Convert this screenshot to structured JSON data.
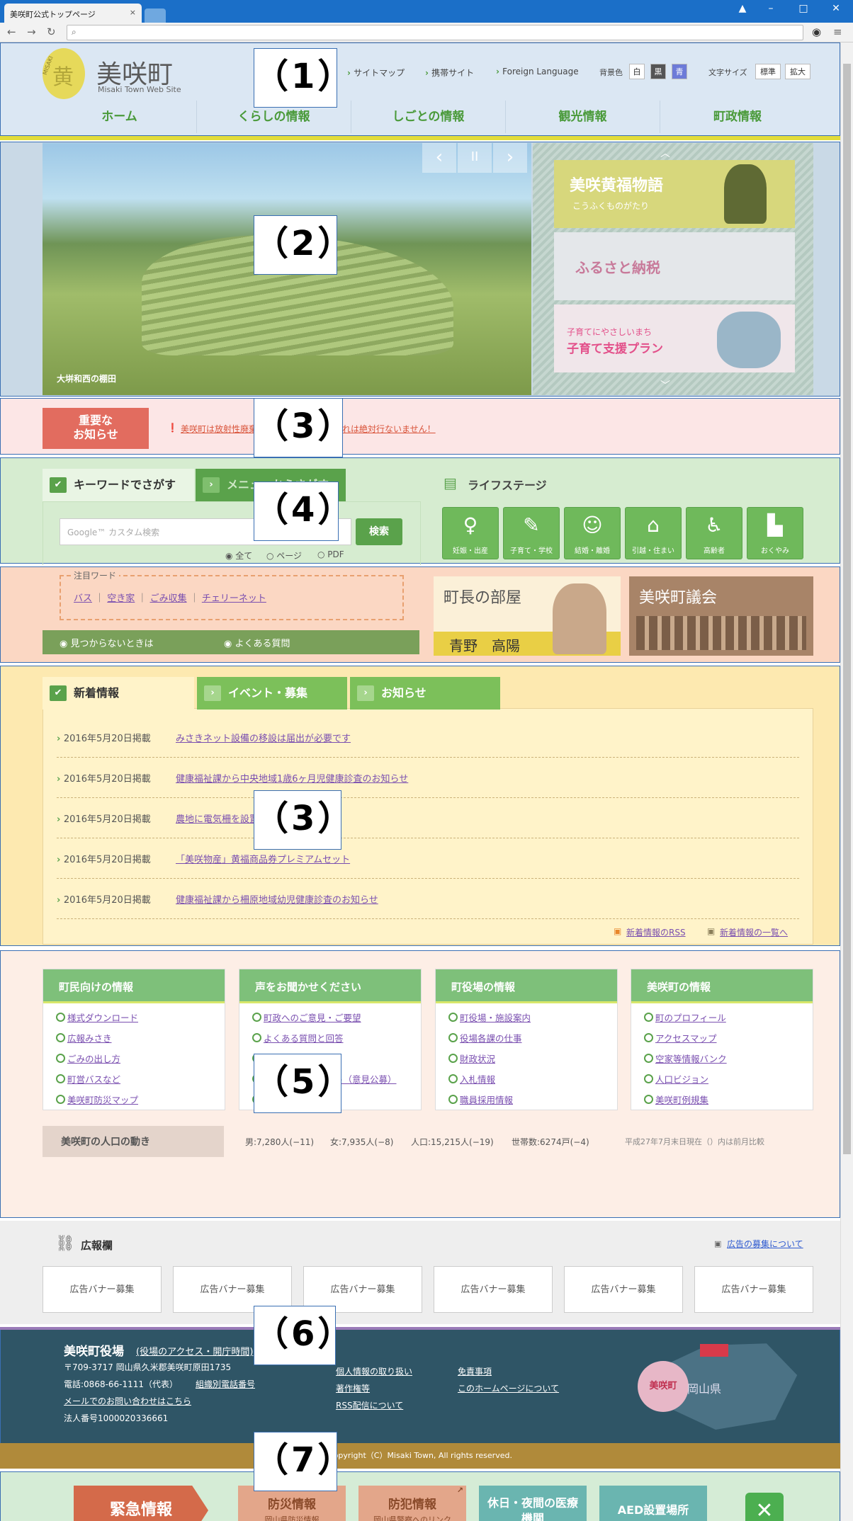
{
  "browser": {
    "tab_title": "美咲町公式トップページ",
    "tab_close": "×",
    "url": ""
  },
  "header": {
    "logo_text": "黄",
    "logo_small": "MISAKI",
    "site_title": "美咲町",
    "site_subtitle": "Misaki Town Web Site",
    "links": [
      "サイトマップ",
      "携帯サイト",
      "Foreign Language"
    ],
    "bg_color_label": "背景色",
    "bg_colors": [
      "白",
      "黒",
      "青"
    ],
    "text_size_label": "文字サイズ",
    "text_sizes": [
      "標準",
      "拡大"
    ]
  },
  "nav": [
    "ホーム",
    "くらしの情報",
    "しごとの情報",
    "観光情報",
    "町政情報"
  ],
  "slider": {
    "caption": "大垪和西の棚田",
    "prev": "‹",
    "pause": "II",
    "next": "›",
    "banners": [
      {
        "title": "美咲黄福物語",
        "sub": "こうふくものがたり"
      },
      {
        "title": "ふるさと納税",
        "sub": ""
      },
      {
        "title": "子育て支援プラン",
        "sub": "子育てにやさしいまち"
      }
    ]
  },
  "important": {
    "label_line1": "重要な",
    "label_line2": "お知らせ",
    "text": "美咲町は放射性廃棄物の最終処分場の受入れは絶対行ないません！"
  },
  "search": {
    "tab_keyword": "キーワードでさがす",
    "tab_menu": "メニューからさがす",
    "placeholder": "Google™ カスタム検索",
    "button": "検索",
    "radios": [
      "全て",
      "ページ",
      "PDF"
    ],
    "attention_title": "注目ワード",
    "attention_words": [
      "バス",
      "空き家",
      "ごみ収集",
      "チェリーネット"
    ],
    "not_found": "見つからないときは",
    "faq": "よくある質問"
  },
  "lifestage": {
    "title": "ライフステージ",
    "items": [
      "妊娠・出産",
      "子育て・学校",
      "結婚・離婚",
      "引越・住まい",
      "高齢者",
      "おくやみ"
    ]
  },
  "mayor": {
    "title": "町長の部屋",
    "name": "青野　高陽"
  },
  "council": {
    "title": "美咲町議会"
  },
  "news": {
    "tabs": [
      "新着情報",
      "イベント・募集",
      "お知らせ"
    ],
    "items": [
      {
        "date": "2016年5月20日掲載",
        "title": "みさきネット設備の移設は届出が必要です"
      },
      {
        "date": "2016年5月20日掲載",
        "title": "健康福祉課から中央地域1歳6ヶ月児健康診査のお知らせ"
      },
      {
        "date": "2016年5月20日掲載",
        "title": "農地に電気柵を設置する場合の注意点"
      },
      {
        "date": "2016年5月20日掲載",
        "title": "「美咲物産」黄福商品券プレミアムセット"
      },
      {
        "date": "2016年5月20日掲載",
        "title": "健康福祉課から柵原地域幼児健康診査のお知らせ"
      }
    ],
    "rss": "新着情報のRSS",
    "list": "新着情報の一覧へ"
  },
  "columns": [
    {
      "title": "町民向けの情報",
      "links": [
        "様式ダウンロード",
        "広報みさき",
        "ごみの出し方",
        "町営バスなど",
        "美咲町防災マップ"
      ]
    },
    {
      "title": "声をお聞かせください",
      "links": [
        "町政へのご意見・ご要望",
        "よくある質問と回答",
        "各種相談窓口",
        "パブリックコメント（意見公募）",
        "アンケート結果"
      ]
    },
    {
      "title": "町役場の情報",
      "links": [
        "町役場・施設案内",
        "役場各課の仕事",
        "財政状況",
        "入札情報",
        "職員採用情報"
      ]
    },
    {
      "title": "美咲町の情報",
      "links": [
        "町のプロフィール",
        "アクセスマップ",
        "空家等情報バンク",
        "人口ビジョン",
        "美咲町例規集"
      ]
    }
  ],
  "population": {
    "label": "美咲町の人口の動き",
    "male": "男:7,280人(−11)",
    "female": "女:7,935人(−8)",
    "total": "人口:15,215人(−19)",
    "households": "世帯数:6274戸(−4)",
    "note": "平成27年7月末日現在（）内は前月比較"
  },
  "ads": {
    "title": "広報欄",
    "about": "広告の募集について",
    "banner": "広告バナー募集"
  },
  "footer": {
    "office": "美咲町役場",
    "office_link": "(役場のアクセス・開庁時間)",
    "address": "〒709-3717  岡山県久米郡美咲町原田1735",
    "phone": "電話:0868-66-1111（代表）",
    "dept_phone": "組織別電話番号",
    "contact": "メールでのお問い合わせはこちら",
    "corp_no": "法人番号1000020336661",
    "links": [
      "個人情報の取り扱い",
      "著作権等",
      "RSS配信について",
      "免責事項",
      "このホームページについて"
    ],
    "map_label": "美咲町",
    "pref": "岡山県",
    "copyright": "Copyright（C）Misaki Town, All rights reserved."
  },
  "emergency": {
    "label": "緊急情報",
    "items": [
      {
        "title": "防災情報",
        "sub": "岡山県防災情報"
      },
      {
        "title": "防犯情報",
        "sub": "岡山県警察へのリンク"
      },
      {
        "title": "休日・夜間の医療機関",
        "sub": ""
      },
      {
        "title": "AED設置場所",
        "sub": ""
      }
    ],
    "close": "✕"
  },
  "annotations": [
    "（1）",
    "（2）",
    "（3）",
    "（4）",
    "（3）",
    "（5）",
    "（6）",
    "（7）"
  ]
}
